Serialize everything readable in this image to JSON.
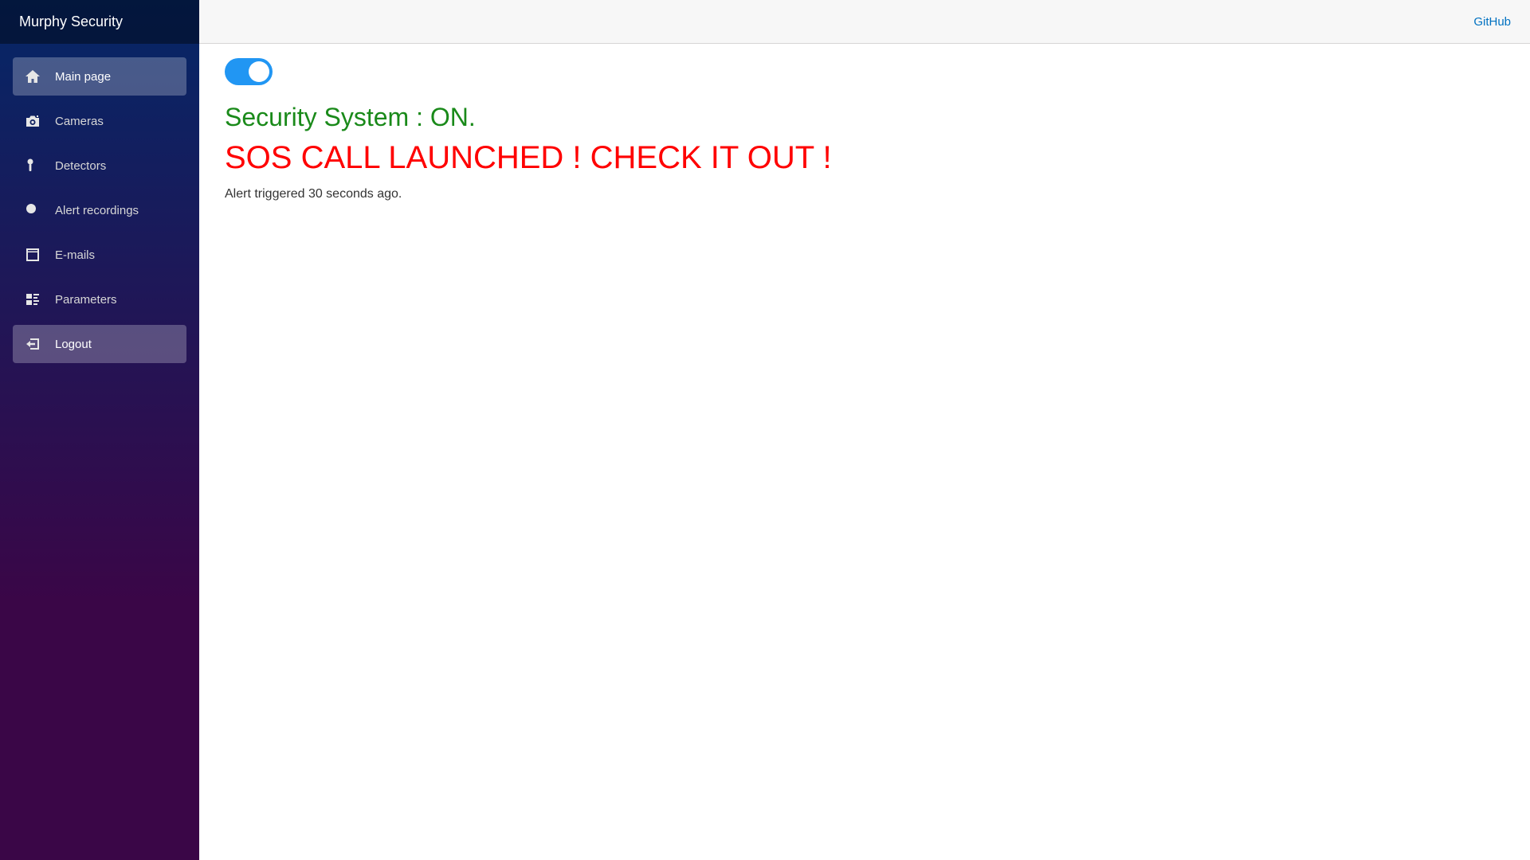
{
  "sidebar": {
    "brand": "Murphy Security",
    "items": [
      {
        "label": "Main page",
        "icon": "home-icon"
      },
      {
        "label": "Cameras",
        "icon": "camera-icon"
      },
      {
        "label": "Detectors",
        "icon": "detector-icon"
      },
      {
        "label": "Alert recordings",
        "icon": "record-icon"
      },
      {
        "label": "E-mails",
        "icon": "email-icon"
      },
      {
        "label": "Parameters",
        "icon": "parameters-icon"
      },
      {
        "label": "Logout",
        "icon": "logout-icon"
      }
    ]
  },
  "header": {
    "github_label": "GitHub"
  },
  "main": {
    "toggle_state": "on",
    "status_text": "Security System : ON.",
    "sos_text": "SOS CALL LAUNCHED ! CHECK IT OUT !",
    "alert_note": "Alert triggered 30 seconds ago."
  },
  "colors": {
    "accent": "#2196f3",
    "status_on": "#1a8a1a",
    "sos": "#ff0000",
    "link": "#0071c1"
  }
}
